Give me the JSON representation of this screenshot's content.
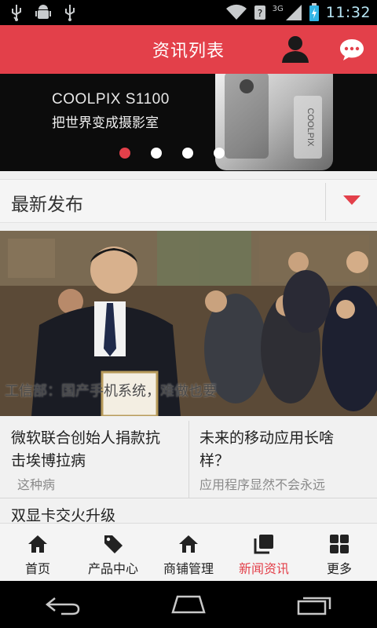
{
  "status_bar": {
    "time": "11:32",
    "network": "3G",
    "icons": [
      "usb-icon",
      "android-debug-icon",
      "usb-icon",
      "wifi-icon",
      "sim-unknown-icon",
      "signal-icon",
      "battery-charging-icon"
    ]
  },
  "header": {
    "title": "资讯列表",
    "icons": [
      "user-icon",
      "message-icon"
    ]
  },
  "banner": {
    "brand": "COOLPIX S1100",
    "tagline": "把世界变成摄影室",
    "camera_brand": "COOLPIX",
    "slide_count": 5,
    "active_slide": 0
  },
  "section": {
    "label": "最新发布",
    "dropdown_icon": "caret-down-icon"
  },
  "featured": {
    "caption": "工信部：国产手机系统，难做也要"
  },
  "news": [
    {
      "headline_line1": "微软联合创始人捐款抗",
      "headline_line2": "击埃博拉病",
      "summary": "这种病"
    },
    {
      "headline_line1": "未来的移动应用长啥",
      "headline_line2": "样？",
      "summary": "应用程序显然不会永远"
    },
    {
      "headline": "双显卡交火升级"
    }
  ],
  "tabs": [
    {
      "label": "首页",
      "icon": "home-icon"
    },
    {
      "label": "产品中心",
      "icon": "tag-icon"
    },
    {
      "label": "商铺管理",
      "icon": "shop-icon"
    },
    {
      "label": "新闻资讯",
      "icon": "news-icon",
      "active": true
    },
    {
      "label": "更多",
      "icon": "grid-icon"
    }
  ],
  "colors": {
    "accent": "#e3404a",
    "tab_active": "#e3404a",
    "background": "#f1f1f1"
  }
}
